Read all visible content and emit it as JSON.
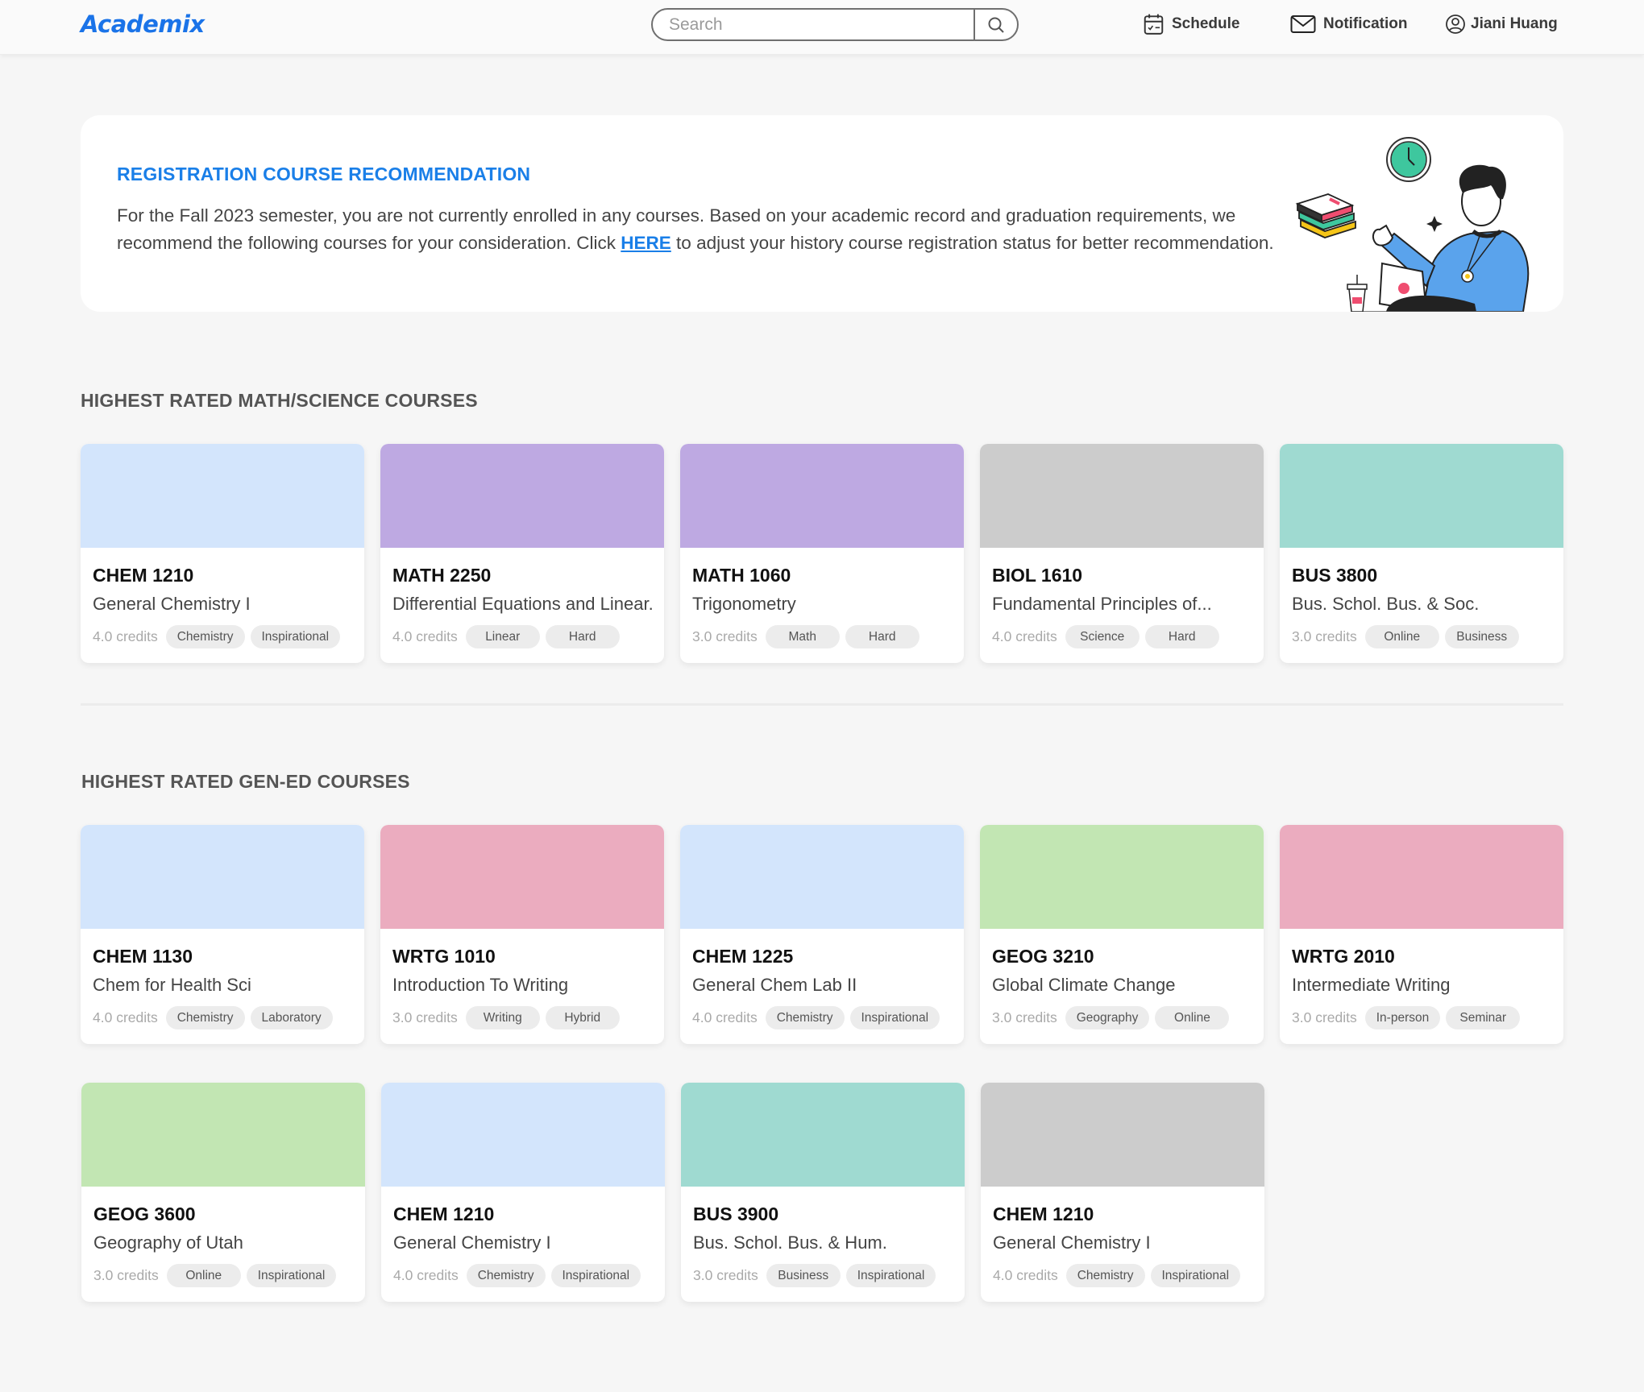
{
  "header": {
    "logo": "Academix",
    "search_placeholder": "Search",
    "search_value": "",
    "nav": {
      "schedule": "Schedule",
      "notification": "Notification",
      "user": "Jiani Huang"
    },
    "brand_color": "#1a73e8"
  },
  "banner": {
    "title": "REGISTRATION COURSE RECOMMENDATION",
    "text_before_link": "For the Fall 2023 semester, you are not currently enrolled in any courses. Based on your academic record and graduation requirements, we recommend the following courses for your consideration. Click ",
    "link_text": "HERE",
    "text_after_link": " to adjust your history course registration status for better recommendation.",
    "illustration": "student-with-laptop-illustration"
  },
  "sections": [
    {
      "title": "HIGHEST RATED MATH/SCIENCE COURSES",
      "courses": [
        {
          "code": "CHEM 1210",
          "title": "General Chemistry I",
          "credits": "4.0 credits",
          "tags": [
            "Chemistry",
            "Inspirational"
          ],
          "color": "#d3e5fc"
        },
        {
          "code": "MATH 2250",
          "title": "Differential Equations and Linear..",
          "credits": "4.0 credits",
          "tags": [
            "Linear",
            "Hard"
          ],
          "color": "#bea9e2"
        },
        {
          "code": "MATH 1060",
          "title": "Trigonometry",
          "credits": "3.0 credits",
          "tags": [
            "Math",
            "Hard"
          ],
          "color": "#bea9e2"
        },
        {
          "code": "BIOL 1610",
          "title": "Fundamental Principles of...",
          "credits": "4.0 credits",
          "tags": [
            "Science",
            "Hard"
          ],
          "color": "#cccccc"
        },
        {
          "code": "BUS 3800",
          "title": "Bus. Schol. Bus. & Soc.",
          "credits": "3.0 credits",
          "tags": [
            "Online",
            "Business"
          ],
          "color": "#9fdad1"
        }
      ]
    },
    {
      "title": "HIGHEST RATED GEN-ED COURSES",
      "courses": [
        {
          "code": "CHEM 1130",
          "title": "Chem for Health Sci",
          "credits": "4.0 credits",
          "tags": [
            "Chemistry",
            "Laboratory"
          ],
          "color": "#d3e5fc"
        },
        {
          "code": "WRTG 1010",
          "title": "Introduction To Writing",
          "credits": "3.0 credits",
          "tags": [
            "Writing",
            "Hybrid"
          ],
          "color": "#ebacbf"
        },
        {
          "code": "CHEM 1225",
          "title": "General Chem Lab II",
          "credits": "4.0 credits",
          "tags": [
            "Chemistry",
            "Inspirational"
          ],
          "color": "#d3e5fc"
        },
        {
          "code": "GEOG 3210",
          "title": "Global Climate Change",
          "credits": "3.0 credits",
          "tags": [
            "Geography",
            "Online"
          ],
          "color": "#c2e6b3"
        },
        {
          "code": "WRTG 2010",
          "title": "Intermediate Writing",
          "credits": "3.0 credits",
          "tags": [
            "In-person",
            "Seminar"
          ],
          "color": "#ebacbf"
        },
        {
          "code": "GEOG 3600",
          "title": "Geography of Utah",
          "credits": "3.0 credits",
          "tags": [
            "Online",
            "Inspirational"
          ],
          "color": "#c2e6b3"
        },
        {
          "code": "CHEM 1210",
          "title": "General Chemistry I",
          "credits": "4.0 credits",
          "tags": [
            "Chemistry",
            "Inspirational"
          ],
          "color": "#d3e5fc"
        },
        {
          "code": "BUS 3900",
          "title": "Bus. Schol. Bus. & Hum.",
          "credits": "3.0 credits",
          "tags": [
            "Business",
            "Inspirational"
          ],
          "color": "#9fdad1"
        },
        {
          "code": "CHEM 1210",
          "title": "General Chemistry I",
          "credits": "4.0 credits",
          "tags": [
            "Chemistry",
            "Inspirational"
          ],
          "color": "#cccccc"
        }
      ]
    }
  ]
}
